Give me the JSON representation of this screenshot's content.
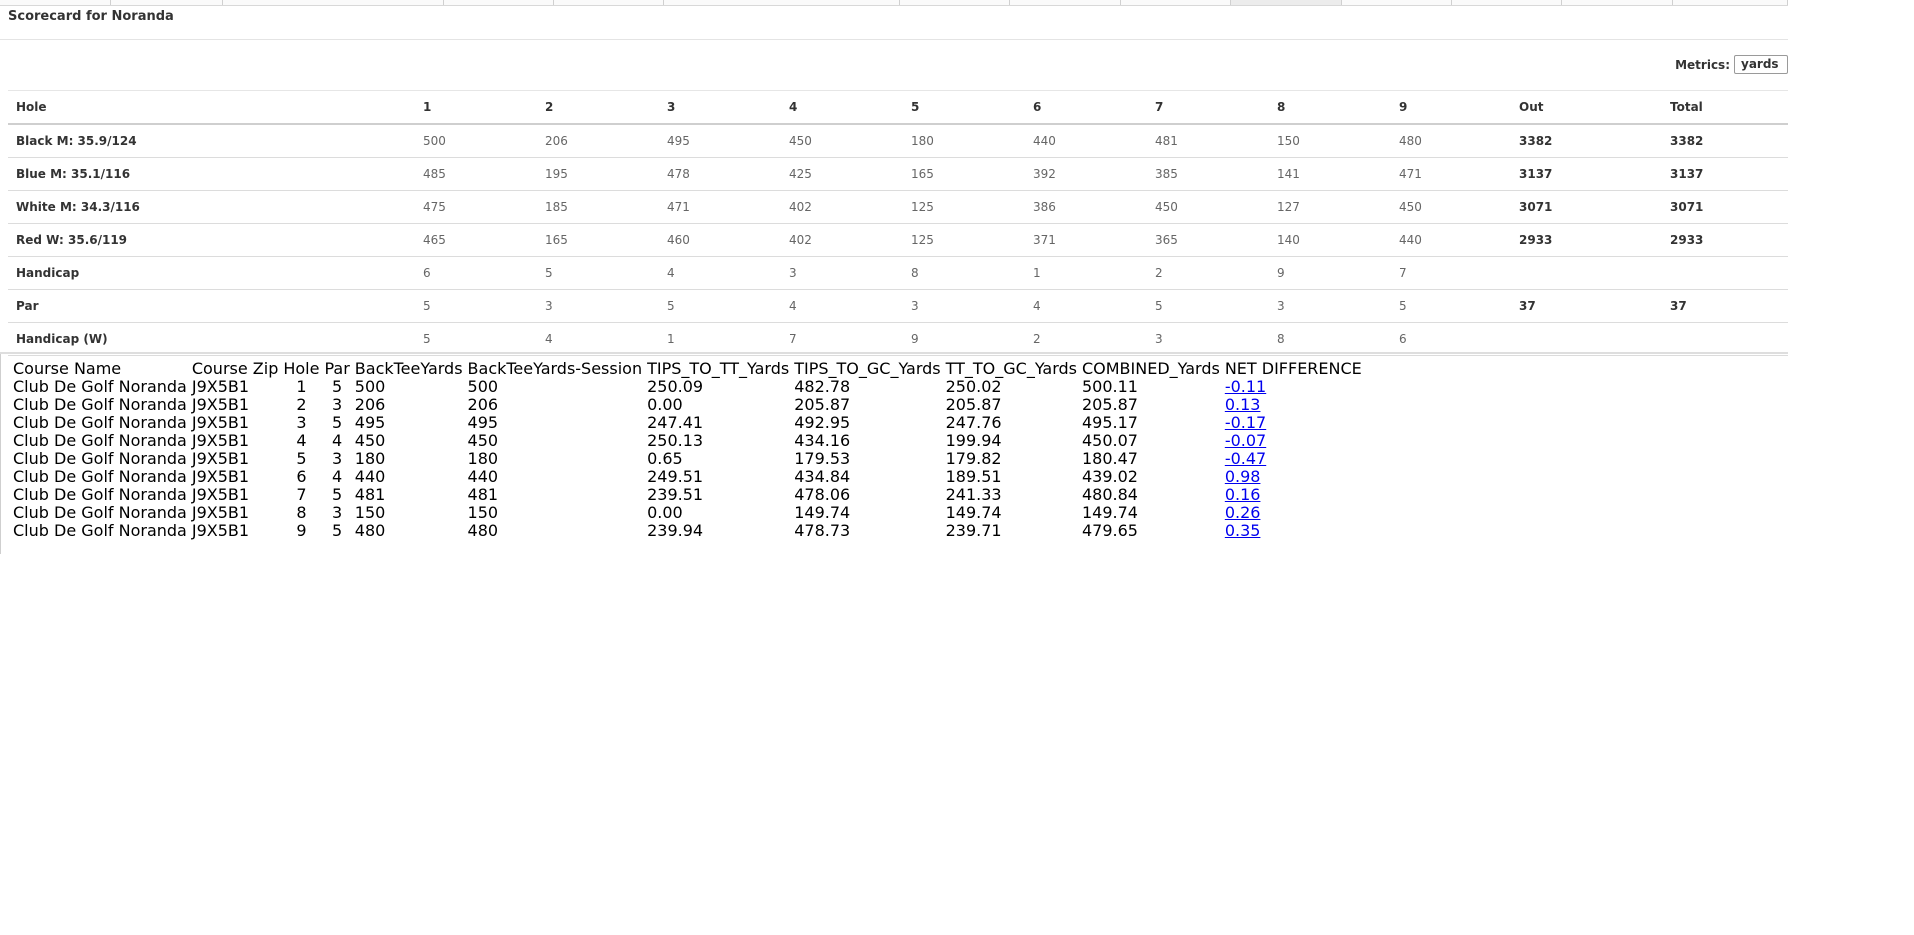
{
  "scorecard": {
    "title": "Scorecard for Noranda",
    "metrics_label": "Metrics:",
    "metrics_value": "yards",
    "headers": [
      "Hole",
      "1",
      "2",
      "3",
      "4",
      "5",
      "6",
      "7",
      "8",
      "9",
      "Out",
      "Total"
    ],
    "rows": [
      {
        "label": "Black M: 35.9/124",
        "values": [
          "500",
          "206",
          "495",
          "450",
          "180",
          "440",
          "481",
          "150",
          "480"
        ],
        "out": "3382",
        "total": "3382"
      },
      {
        "label": "Blue M: 35.1/116",
        "values": [
          "485",
          "195",
          "478",
          "425",
          "165",
          "392",
          "385",
          "141",
          "471"
        ],
        "out": "3137",
        "total": "3137"
      },
      {
        "label": "White M: 34.3/116",
        "values": [
          "475",
          "185",
          "471",
          "402",
          "125",
          "386",
          "450",
          "127",
          "450"
        ],
        "out": "3071",
        "total": "3071"
      },
      {
        "label": "Red W: 35.6/119",
        "values": [
          "465",
          "165",
          "460",
          "402",
          "125",
          "371",
          "365",
          "140",
          "440"
        ],
        "out": "2933",
        "total": "2933"
      },
      {
        "label": "Handicap",
        "values": [
          "6",
          "5",
          "4",
          "3",
          "8",
          "1",
          "2",
          "9",
          "7"
        ],
        "out": "",
        "total": ""
      },
      {
        "label": "Par",
        "values": [
          "5",
          "3",
          "5",
          "4",
          "3",
          "4",
          "5",
          "3",
          "5"
        ],
        "out": "37",
        "total": "37"
      },
      {
        "label": "Handicap (W)",
        "values": [
          "5",
          "4",
          "1",
          "7",
          "9",
          "2",
          "3",
          "8",
          "6"
        ],
        "out": "",
        "total": ""
      }
    ]
  },
  "data_table": {
    "headers": [
      "Course Name",
      "Course Zip",
      "Hole",
      "Par",
      "BackTeeYards",
      "BackTeeYards-Session",
      "TIPS_TO_TT_Yards",
      "TIPS_TO_GC_Yards",
      "TT_TO_GC_Yards",
      "COMBINED_Yards",
      "NET DIFFERENCE"
    ],
    "rows": [
      [
        "Club De Golf Noranda",
        "J9X5B1",
        "1",
        "5",
        "500",
        "500",
        "250.09",
        "482.78",
        "250.02",
        "500.11",
        "-0.11"
      ],
      [
        "Club De Golf Noranda",
        "J9X5B1",
        "2",
        "3",
        "206",
        "206",
        "0.00",
        "205.87",
        "205.87",
        "205.87",
        "0.13"
      ],
      [
        "Club De Golf Noranda",
        "J9X5B1",
        "3",
        "5",
        "495",
        "495",
        "247.41",
        "492.95",
        "247.76",
        "495.17",
        "-0.17"
      ],
      [
        "Club De Golf Noranda",
        "J9X5B1",
        "4",
        "4",
        "450",
        "450",
        "250.13",
        "434.16",
        "199.94",
        "450.07",
        "-0.07"
      ],
      [
        "Club De Golf Noranda",
        "J9X5B1",
        "5",
        "3",
        "180",
        "180",
        "0.65",
        "179.53",
        "179.82",
        "180.47",
        "-0.47"
      ],
      [
        "Club De Golf Noranda",
        "J9X5B1",
        "6",
        "4",
        "440",
        "440",
        "249.51",
        "434.84",
        "189.51",
        "439.02",
        "0.98"
      ],
      [
        "Club De Golf Noranda",
        "J9X5B1",
        "7",
        "5",
        "481",
        "481",
        "239.51",
        "478.06",
        "241.33",
        "480.84",
        "0.16"
      ],
      [
        "Club De Golf Noranda",
        "J9X5B1",
        "8",
        "3",
        "150",
        "150",
        "0.00",
        "149.74",
        "149.74",
        "149.74",
        "0.26"
      ],
      [
        "Club De Golf Noranda",
        "J9X5B1",
        "9",
        "5",
        "480",
        "480",
        "239.94",
        "478.73",
        "239.71",
        "479.65",
        "0.35"
      ]
    ]
  }
}
